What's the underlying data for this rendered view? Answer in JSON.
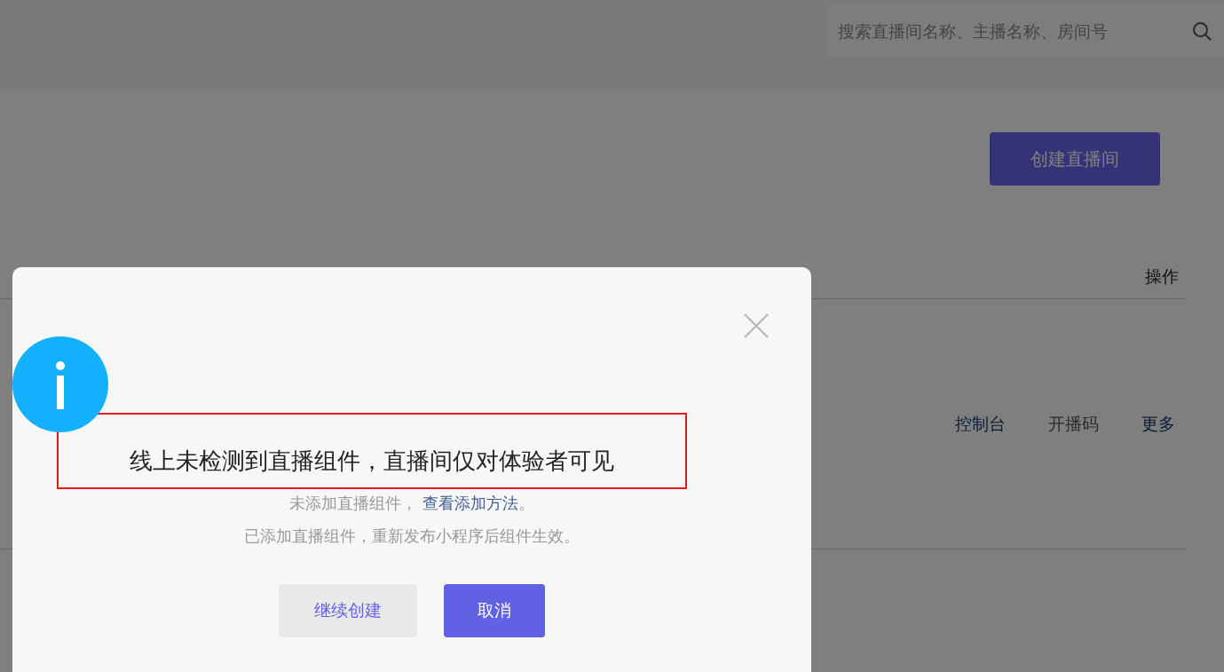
{
  "search": {
    "placeholder": "搜索直播间名称、主播名称、房间号"
  },
  "create_button": "创建直播间",
  "table": {
    "columns": [
      {
        "label": "操作"
      }
    ],
    "rows": [
      {
        "actions": [
          {
            "label": "控制台",
            "disabled": false
          },
          {
            "label": "开播码",
            "disabled": true
          },
          {
            "label": "更多",
            "disabled": false
          }
        ]
      }
    ]
  },
  "dialog": {
    "title": "线上未检测到直播组件，直播间仅对体验者可见",
    "highlighted": true,
    "hint": {
      "text": "未添加直播组件，",
      "link": "查看添加方法",
      "end": "。"
    },
    "note": "已添加直播组件，重新发布小程序后组件生效。",
    "buttons": [
      {
        "label": "继续创建",
        "kind": "secondary"
      },
      {
        "label": "取消",
        "kind": "primary"
      }
    ]
  }
}
